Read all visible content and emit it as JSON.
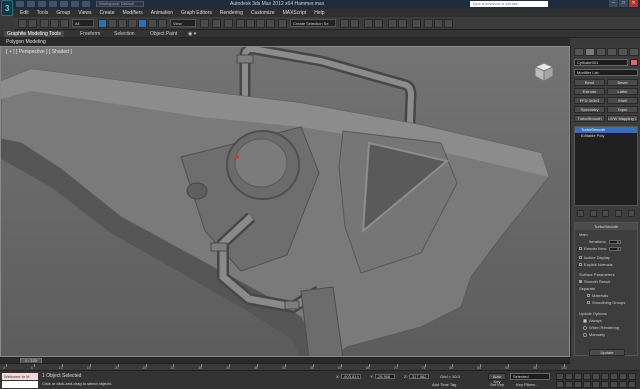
{
  "window": {
    "title": "Autodesk 3ds Max 2012 x64   Hammer.max",
    "search_placeholder": "Type a keyword or phrase",
    "app_logo": "3ds-max-logo",
    "workspace": "Workspace: Default"
  },
  "menu": [
    "Edit",
    "Tools",
    "Group",
    "Views",
    "Create",
    "Modifiers",
    "Animation",
    "Graph Editors",
    "Rendering",
    "Customize",
    "MAXScript",
    "Help"
  ],
  "toolbar": {
    "selection_filter": "All",
    "ref_coord": "View",
    "named_selection": "Create Selection Se"
  },
  "ribbon": {
    "tabs": [
      "Graphite Modeling Tools",
      "Freeform",
      "Selection",
      "Object Paint"
    ],
    "active_tab": "Graphite Modeling Tools",
    "panel": "Polygon Modeling"
  },
  "viewport": {
    "label": "[ + ] [ Perspective ] [ Shaded ]",
    "bg_color": "#6f6f6f",
    "model_color": "#7e7e7e"
  },
  "command_panel": {
    "object_name": "Cylinder001",
    "object_color": "#d46c6c",
    "modifier_list": "Modifier List",
    "modifier_buttons": [
      "Bend",
      "Bevel",
      "Extrude",
      "Lathe",
      "FFD 3x3x3",
      "Shell",
      "Symmetry",
      "Taper",
      "TurboSmooth",
      "UVW Mapping Cle"
    ],
    "stack": [
      {
        "label": "TurboSmooth",
        "selected": true
      },
      {
        "label": "Editable Poly",
        "selected": false
      }
    ],
    "turbosmooth": {
      "title": "TurboSmooth",
      "main_label": "Main",
      "iterations_label": "Iterations:",
      "iterations": "0",
      "render_iters_label": "Render Iters:",
      "render_iters": "0",
      "isoline_label": "Isoline Display",
      "explicit_label": "Explicit Normals",
      "surface_label": "Surface Parameters",
      "smooth_result_label": "Smooth Result",
      "separate_label": "Separate",
      "materials_label": "Materials",
      "smoothing_groups_label": "Smoothing Groups",
      "update_options_label": "Update Options",
      "always_label": "Always",
      "when_rendering_label": "When Rendering",
      "manually_label": "Manually",
      "update_button": "Update"
    }
  },
  "timeline": {
    "frame_display": "0 / 100",
    "tick_labels": [
      "0",
      "5",
      "10",
      "15",
      "20",
      "25",
      "30",
      "35",
      "40",
      "45",
      "50",
      "55",
      "60",
      "65",
      "70",
      "75",
      "80",
      "85",
      "90",
      "95",
      "100"
    ]
  },
  "status": {
    "maxscript_label": "Welcome to M",
    "selection_text": "1 Object Selected",
    "prompt_text": "Click or click-and-drag to select objects",
    "x_label": "X:",
    "x_value": "-603.814",
    "y_label": "Y:",
    "y_value": "-28.906",
    "z_label": "Z:",
    "z_value": "-317.982",
    "grid_label": "Grid = 10.0",
    "add_time_tag": "Add Time Tag",
    "auto_key": "Auto Key",
    "set_key": "Set Key",
    "selected_label": "Selected",
    "key_filters": "Key Filters..."
  }
}
